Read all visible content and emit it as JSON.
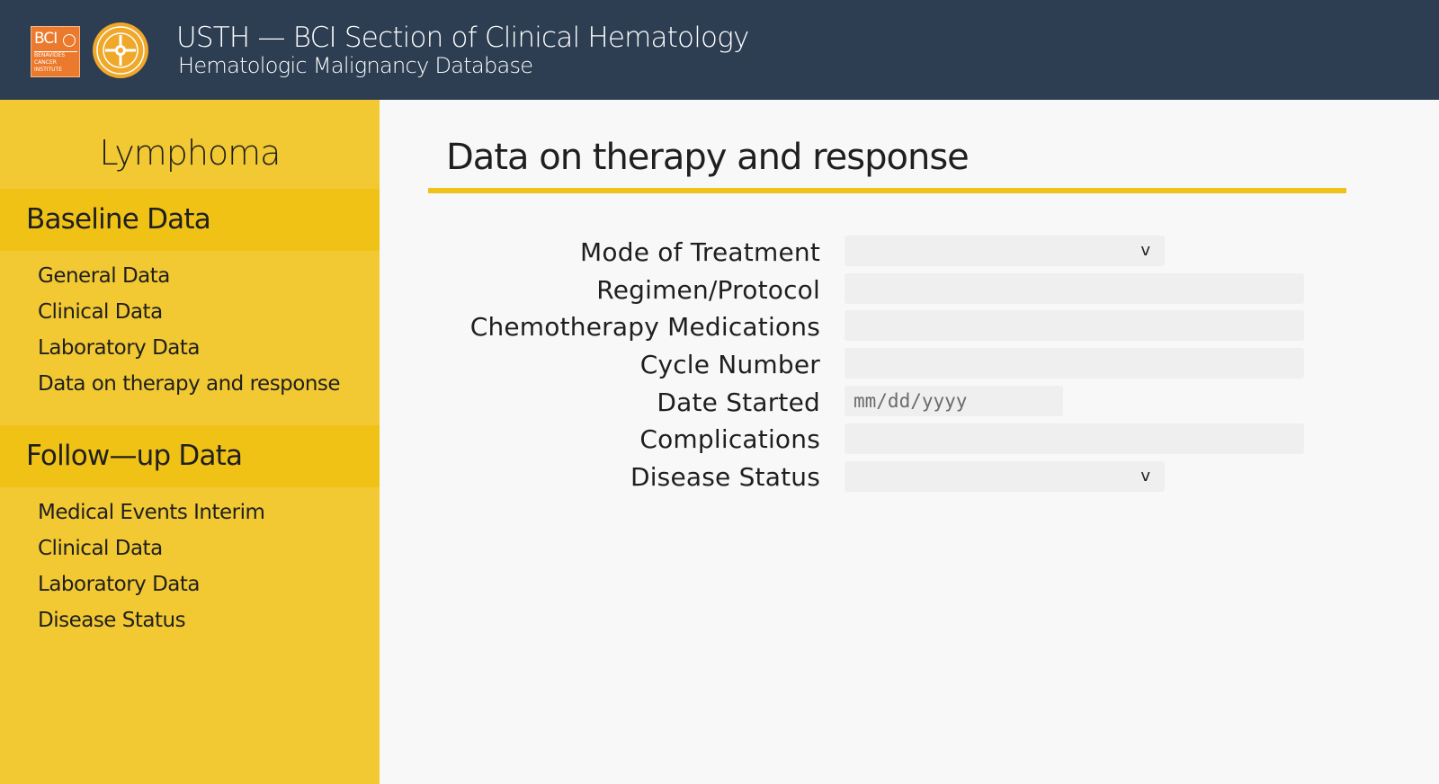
{
  "header": {
    "title": "USTH — BCI Section of Clinical Hematology",
    "subtitle": "Hematologic Malignancy Database",
    "logo_text": "BCI",
    "logo_subtext": "BENAVIDES CANCER INSTITUTE"
  },
  "sidebar": {
    "title": "Lymphoma",
    "sections": [
      {
        "label": "Baseline Data",
        "items": [
          "General Data",
          "Clinical Data",
          "Laboratory Data",
          "Data on therapy and response"
        ]
      },
      {
        "label": "Follow—up Data",
        "items": [
          "Medical Events Interim",
          "Clinical Data",
          "Laboratory Data",
          "Disease Status"
        ]
      }
    ]
  },
  "main": {
    "title": "Data on therapy and response",
    "fields": [
      {
        "label": "Mode of Treatment",
        "value": ""
      },
      {
        "label": "Regimen/Protocol",
        "value": ""
      },
      {
        "label": "Chemotherapy Medications",
        "value": ""
      },
      {
        "label": "Cycle Number",
        "value": ""
      },
      {
        "label": "Date Started",
        "placeholder": "mm/dd/yyyy"
      },
      {
        "label": "Complications",
        "value": ""
      },
      {
        "label": "Disease Status",
        "value": ""
      }
    ],
    "select_chevron": "v"
  },
  "colors": {
    "header_bg": "#2d3e52",
    "sidebar_bg": "#f2c932",
    "section_bg": "#f0c216",
    "accent_rule": "#efc21a",
    "logo_orange": "#ec7a2c"
  }
}
